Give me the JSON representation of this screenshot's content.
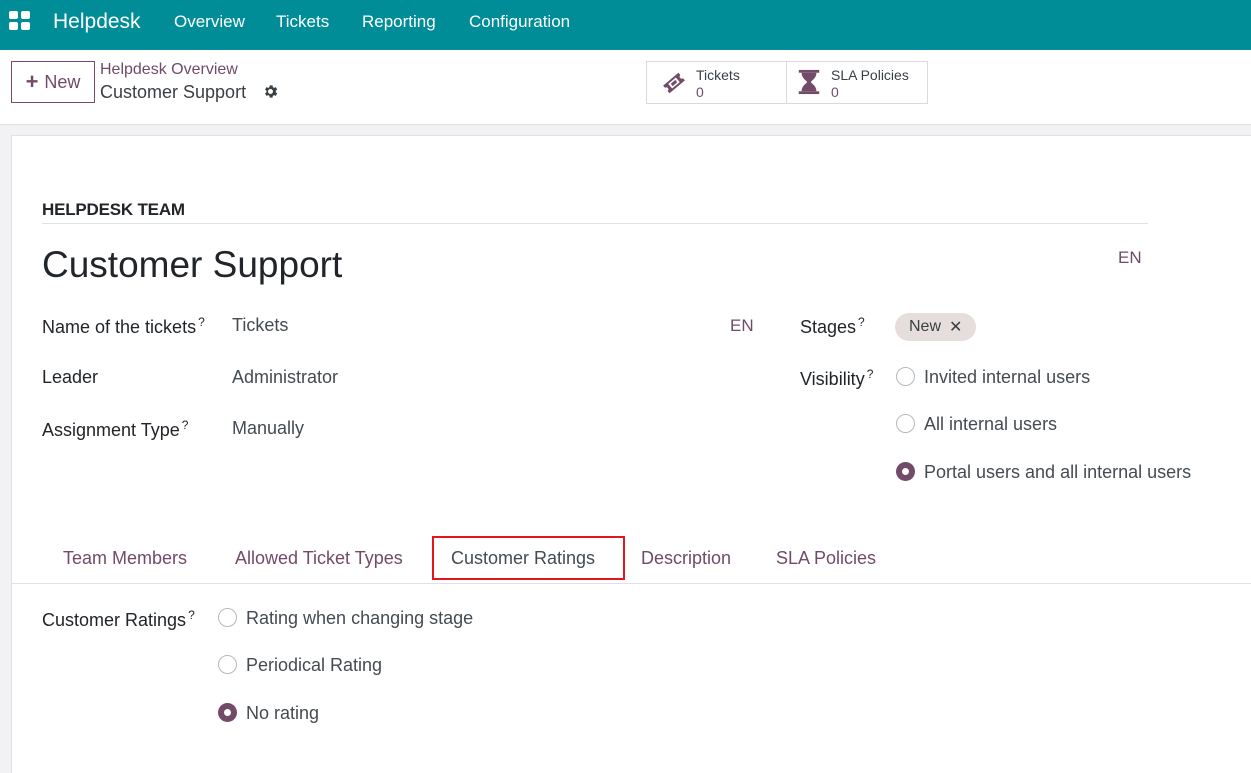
{
  "navbar": {
    "brand": "Helpdesk",
    "menu": [
      "Overview",
      "Tickets",
      "Reporting",
      "Configuration"
    ]
  },
  "control_panel": {
    "new_button": "New",
    "breadcrumb_parent": "Helpdesk Overview",
    "breadcrumb_current": "Customer Support",
    "smart_buttons": [
      {
        "label": "Tickets",
        "value": "0",
        "icon": "ticket-icon"
      },
      {
        "label": "SLA Policies",
        "value": "0",
        "icon": "hourglass-icon"
      }
    ]
  },
  "form": {
    "section_label": "HELPDESK TEAM",
    "team_name": "Customer Support",
    "lang": "EN",
    "fields": {
      "ticket_name_label": "Name of the tickets",
      "ticket_name_value": "Tickets",
      "leader_label": "Leader",
      "leader_value": "Administrator",
      "assignment_label": "Assignment Type",
      "assignment_value": "Manually",
      "stages_label": "Stages",
      "stage_tag": "New",
      "visibility_label": "Visibility",
      "help_mark": "?"
    },
    "visibility_options": [
      {
        "label": "Invited internal users",
        "checked": false
      },
      {
        "label": "All internal users",
        "checked": false
      },
      {
        "label": "Portal users and all internal users",
        "checked": true
      }
    ]
  },
  "tabs": [
    "Team Members",
    "Allowed Ticket Types",
    "Customer Ratings",
    "Description",
    "SLA Policies"
  ],
  "active_tab": "Customer Ratings",
  "ratings": {
    "label": "Customer Ratings",
    "options": [
      {
        "label": "Rating when changing stage",
        "checked": false
      },
      {
        "label": "Periodical Rating",
        "checked": false
      },
      {
        "label": "No rating",
        "checked": true
      }
    ]
  },
  "colors": {
    "navbar": "#018d98",
    "primary": "#714b67",
    "highlight": "#e3161d"
  }
}
